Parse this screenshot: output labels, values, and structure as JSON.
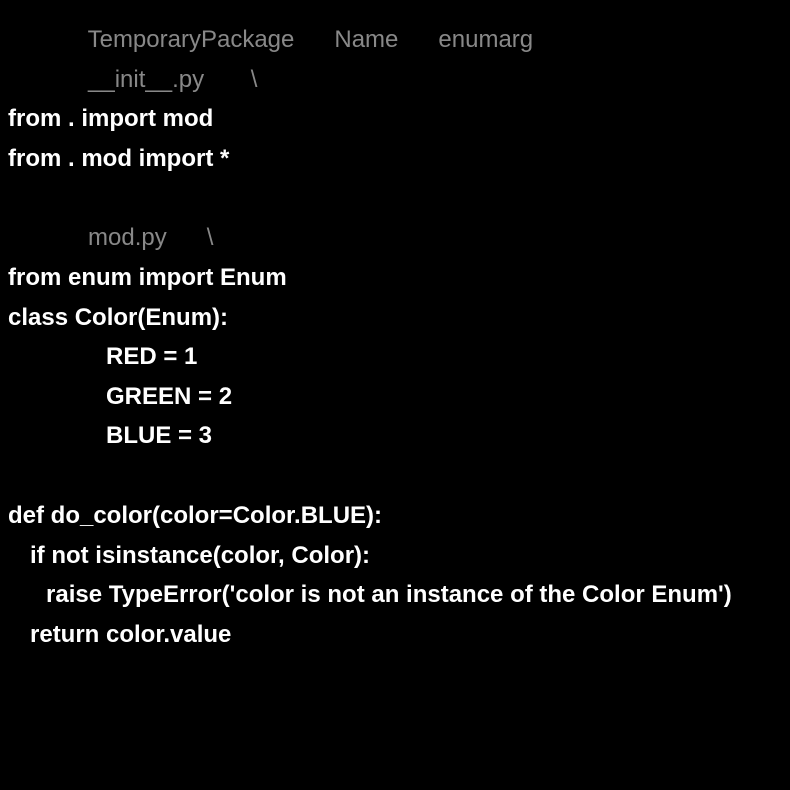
{
  "line1": {
    "prefix": "            ",
    "temp_pkg": "TemporaryPackage",
    "mid1": "      ",
    "name_key": "Name",
    "mid2": "      ",
    "name_val": "enumarg"
  },
  "line2": {
    "prefix": "            ",
    "file": "__init__.py",
    "suffix": "       \\"
  },
  "code_init": [
    "from . import mod",
    "from . mod import *"
  ],
  "line_mod": {
    "prefix": "            ",
    "file": "mod.py",
    "suffix": "      \\"
  },
  "code_mod": {
    "l1": "from enum import Enum",
    "l2": "class Color(Enum):",
    "l3": "RED = 1",
    "l4": "GREEN = 2",
    "l5": "BLUE = 3",
    "l6": "def do_color(color=Color.BLUE):",
    "l7": "if not isinstance(color, Color):",
    "l8": "raise TypeError('color is not an instance of the Color Enum')",
    "l9": "return color.value"
  }
}
